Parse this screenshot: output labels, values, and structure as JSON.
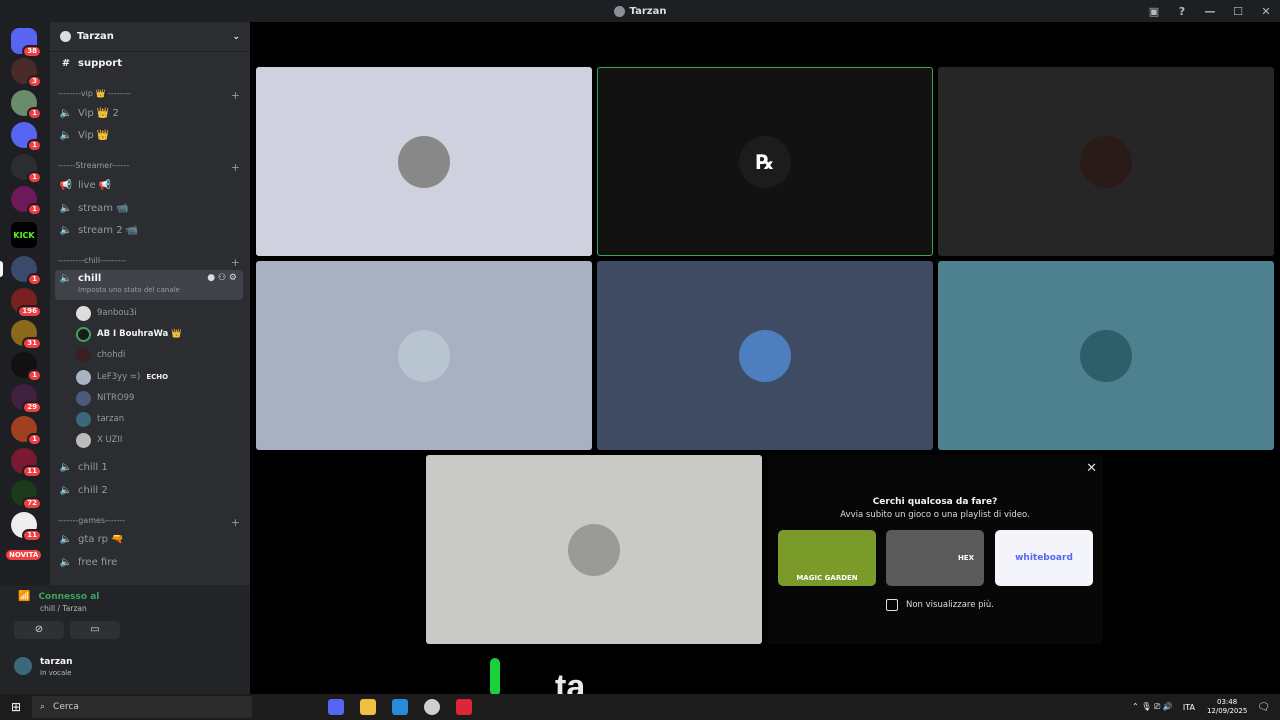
{
  "titlebar": {
    "title": "Tarzan"
  },
  "guilds": {
    "badges": [
      "38",
      "3",
      "1",
      "1",
      "1",
      "1",
      "1",
      "196",
      "31",
      "1",
      "29",
      "1",
      "11",
      "72",
      "11"
    ],
    "novita": "NOVITÀ",
    "kick": "KICK"
  },
  "server": {
    "name": "Tarzan"
  },
  "channels": {
    "support": "support",
    "cat_vip": "--------vip 👑 --------",
    "vip1": "Vip 👑 2",
    "vip2": "Vip 👑",
    "cat_streamer": "------Streamer------",
    "live": "live 📢",
    "stream": "stream 📹",
    "stream2": "stream 2 📹",
    "cat_chill": "---------chill---------",
    "chill": "chill",
    "chill_status": "Imposta uno stato del canale",
    "chill1": "chill 1",
    "chill2": "chill 2",
    "cat_games": "-------games-------",
    "gtarp": "gta rp 🔫",
    "freefire": "free fire"
  },
  "members": [
    "9anbou3i",
    "AB I BouhraWa 👑",
    "chohdi",
    "LeF3yy =)",
    "NITRO99",
    "tarzan",
    "X UZII"
  ],
  "echo_tag": "ECHO",
  "voice_panel": {
    "status": "Connesso al",
    "location": "chill / Tarzan",
    "user": "tarzan",
    "user_status": "In vocale"
  },
  "activity": {
    "title": "Cerchi qualcosa da fare?",
    "subtitle": "Avvia subito un gioco o una playlist di video.",
    "checkbox_label": "Non visualizzare più.",
    "cards": [
      "MAGIC GARDEN",
      "HEX",
      "whiteboard"
    ]
  },
  "overlay_text": "ta",
  "taskbar": {
    "search": "Cerca",
    "lang": "ITA",
    "time": "03:48",
    "date": "12/09/2025"
  },
  "colors": {
    "accent_green": "#3ba55c",
    "badge_red": "#f23f43"
  }
}
